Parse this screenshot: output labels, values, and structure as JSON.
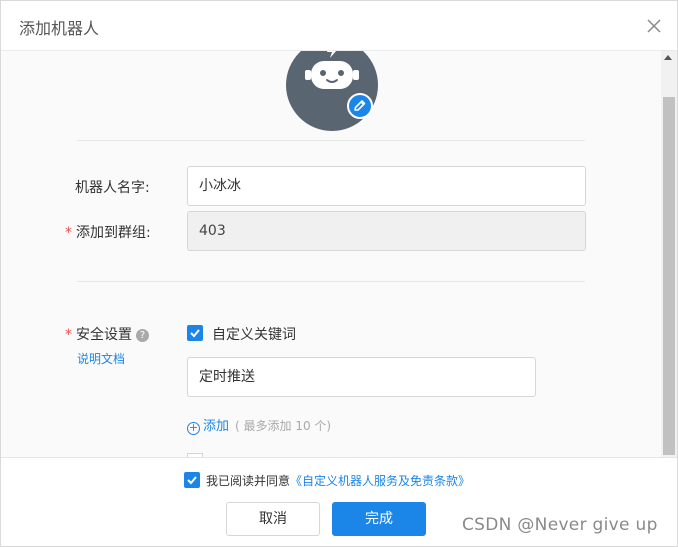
{
  "dialog": {
    "title": "添加机器人"
  },
  "form": {
    "name_label": "机器人名字:",
    "name_value": "小冰冰",
    "group_label": "添加到群组:",
    "group_required": "*",
    "group_value": "403",
    "security_label": "安全设置",
    "security_required": "*",
    "help_glyph": "?",
    "doc_link": "说明文档",
    "keyword_checkbox_label": "自定义关键词",
    "keyword_value": "定时推送",
    "add_label": "添加",
    "add_hint": "( 最多添加 10 个)"
  },
  "footer": {
    "agree_text": "我已阅读并同意",
    "terms_link": "《自定义机器人服务及免责条款》",
    "cancel_label": "取消",
    "ok_label": "完成"
  },
  "watermark": "CSDN @Never  give  up",
  "colors": {
    "primary": "#1b86e8",
    "required": "#e94e4e",
    "avatar_bg": "#5a6572"
  },
  "icons": [
    "close-icon",
    "robot-icon",
    "pencil-icon",
    "help-icon",
    "check-icon",
    "plus-circle-icon"
  ]
}
